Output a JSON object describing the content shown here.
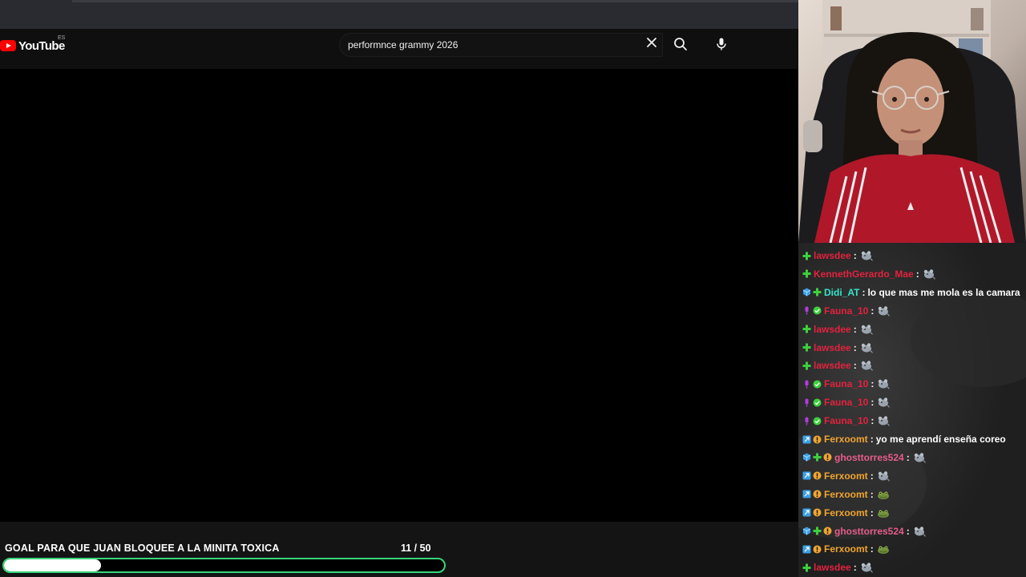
{
  "browser": {
    "tab_strip": ""
  },
  "youtube": {
    "logo_text": "YouTube",
    "country_code": "ES",
    "search_value": "performnce grammy 2026",
    "icons": {
      "clear": "close-icon",
      "search": "search-icon",
      "mic": "microphone-icon"
    }
  },
  "goal": {
    "title": "GOAL PARA QUE JUAN BLOQUEE A LA MINITA TOXICA",
    "count_text": "11  / 50",
    "current": 11,
    "target": 50,
    "progress_fraction": 0.22,
    "bar_color": "#37d67a"
  },
  "colors": {
    "user_red": "#e3223e",
    "user_teal": "#33e6c8",
    "user_orange": "#f0a530",
    "user_pink": "#e65d8c",
    "badge_green": "#3cd03c",
    "badge_blue": "#3aa0e8",
    "badge_purple": "#b43ae0"
  },
  "chat": {
    "messages": [
      {
        "user": "lawsdee",
        "color": "#e3223e",
        "badges": [
          "green-plus"
        ],
        "text": "",
        "emote": "rat"
      },
      {
        "user": "KennethGerardo_Mae",
        "color": "#e3223e",
        "badges": [
          "green-plus"
        ],
        "text": "",
        "emote": "rat"
      },
      {
        "user": "Didi_AT",
        "color": "#33e6c8",
        "badges": [
          "blue-cube",
          "green-plus"
        ],
        "text": "lo que mas me mola es la camara",
        "emote": ""
      },
      {
        "user": "Fauna_10",
        "color": "#e3223e",
        "badges": [
          "purple-mic",
          "green-check"
        ],
        "text": "",
        "emote": "rat"
      },
      {
        "user": "lawsdee",
        "color": "#e3223e",
        "badges": [
          "green-plus"
        ],
        "text": "",
        "emote": "rat"
      },
      {
        "user": "lawsdee",
        "color": "#e3223e",
        "badges": [
          "green-plus"
        ],
        "text": "",
        "emote": "rat"
      },
      {
        "user": "lawsdee",
        "color": "#e3223e",
        "badges": [
          "green-plus"
        ],
        "text": "",
        "emote": "rat"
      },
      {
        "user": "Fauna_10",
        "color": "#e3223e",
        "badges": [
          "purple-mic",
          "green-check"
        ],
        "text": "",
        "emote": "rat"
      },
      {
        "user": "Fauna_10",
        "color": "#e3223e",
        "badges": [
          "purple-mic",
          "green-check"
        ],
        "text": "",
        "emote": "rat"
      },
      {
        "user": "Fauna_10",
        "color": "#e3223e",
        "badges": [
          "purple-mic",
          "green-check"
        ],
        "text": "",
        "emote": "rat"
      },
      {
        "user": "Ferxoomt",
        "color": "#f0a530",
        "badges": [
          "blue-box",
          "orange-info"
        ],
        "text": "yo me aprendí enseña coreo",
        "emote": ""
      },
      {
        "user": "ghosttorres524",
        "color": "#e65d8c",
        "badges": [
          "blue-cube",
          "green-plus",
          "orange-info"
        ],
        "text": "",
        "emote": "rat"
      },
      {
        "user": "Ferxoomt",
        "color": "#f0a530",
        "badges": [
          "blue-box",
          "orange-info"
        ],
        "text": "",
        "emote": "rat"
      },
      {
        "user": "Ferxoomt",
        "color": "#f0a530",
        "badges": [
          "blue-box",
          "orange-info"
        ],
        "text": "",
        "emote": "frog"
      },
      {
        "user": "Ferxoomt",
        "color": "#f0a530",
        "badges": [
          "blue-box",
          "orange-info"
        ],
        "text": "",
        "emote": "frog"
      },
      {
        "user": "ghosttorres524",
        "color": "#e65d8c",
        "badges": [
          "blue-cube",
          "green-plus",
          "orange-info"
        ],
        "text": "",
        "emote": "rat"
      },
      {
        "user": "Ferxoomt",
        "color": "#f0a530",
        "badges": [
          "blue-box",
          "orange-info"
        ],
        "text": "",
        "emote": "frog"
      },
      {
        "user": "lawsdee",
        "color": "#e3223e",
        "badges": [
          "green-plus"
        ],
        "text": "",
        "emote": "rat"
      }
    ]
  }
}
